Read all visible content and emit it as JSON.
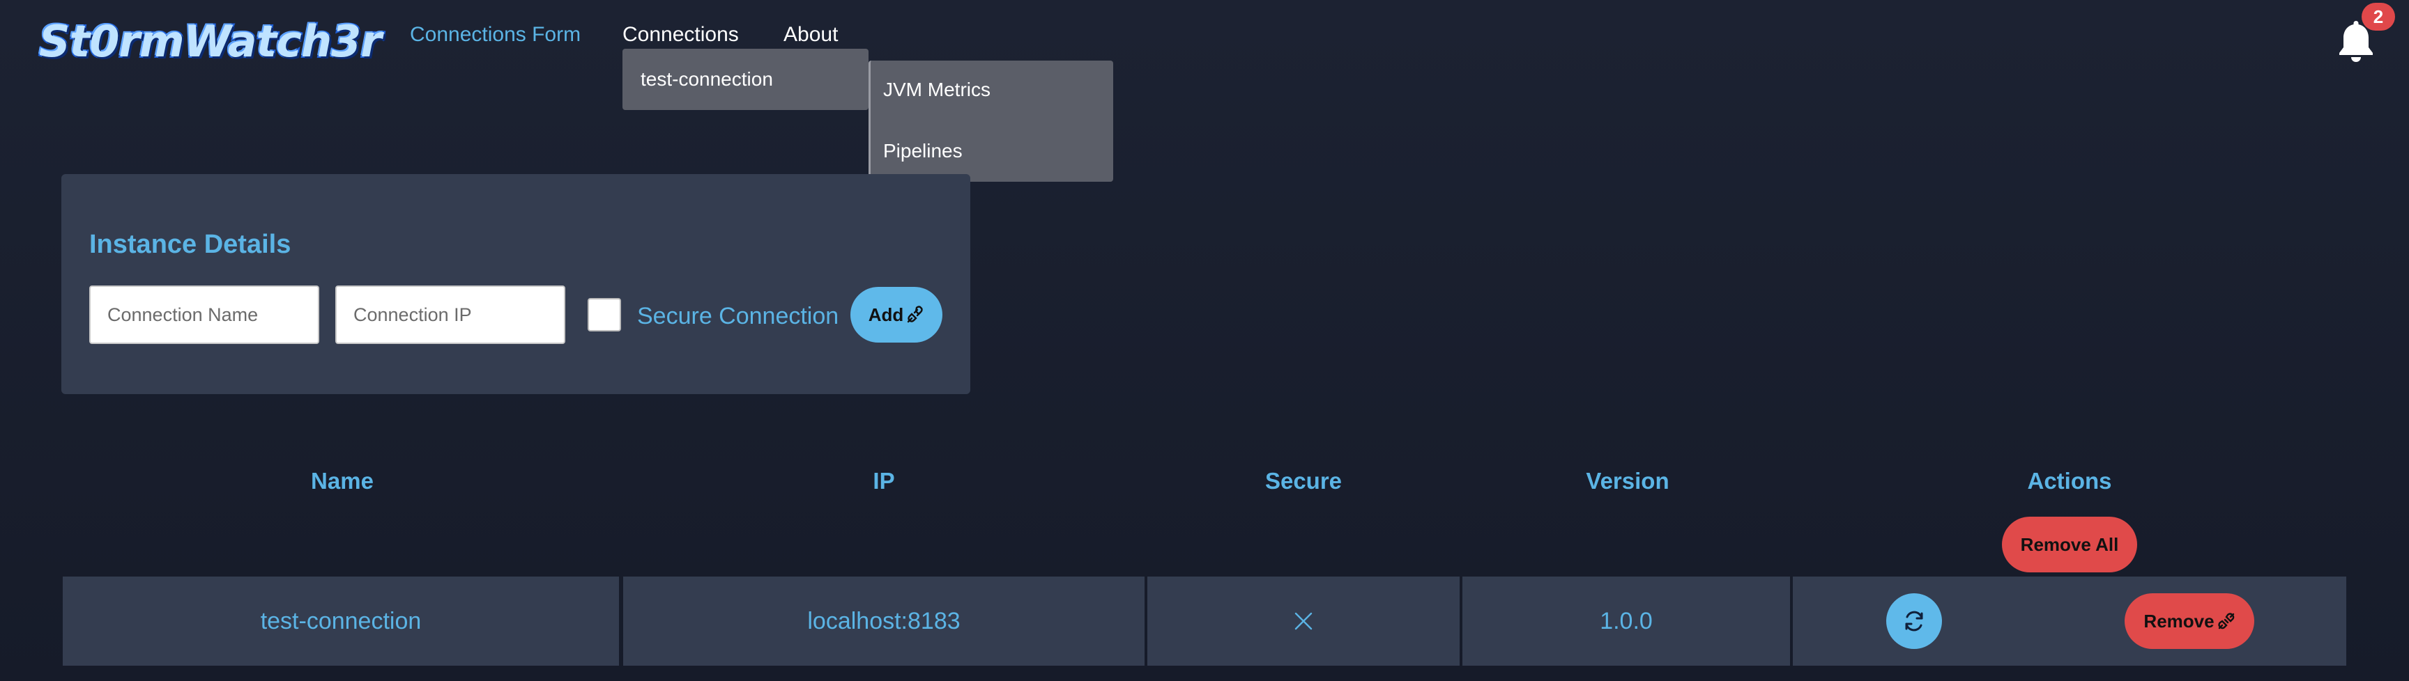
{
  "header": {
    "logo": "St0rmWatch3r",
    "nav": {
      "connections_form": "Connections Form",
      "connections": "Connections",
      "about": "About"
    },
    "notifications": {
      "icon": "bell-icon",
      "count": "2"
    }
  },
  "dropdown": {
    "item": "test-connection",
    "submenu": [
      "JVM Metrics",
      "Pipelines"
    ]
  },
  "form": {
    "title": "Instance Details",
    "name_placeholder": "Connection Name",
    "ip_placeholder": "Connection IP",
    "secure_label": "Secure Connection",
    "secure_checked": false,
    "add_label": "Add"
  },
  "table": {
    "headers": [
      "Name",
      "IP",
      "Secure",
      "Version",
      "Actions"
    ],
    "remove_all_label": "Remove All",
    "rows": [
      {
        "name": "test-connection",
        "ip": "localhost:8183",
        "secure": "false",
        "version": "1.0.0",
        "remove_label": "Remove"
      }
    ]
  },
  "colors": {
    "accent": "#5bb4e5",
    "danger": "#e04a4a",
    "card": "#343d50",
    "background": "#1a1f2e"
  }
}
